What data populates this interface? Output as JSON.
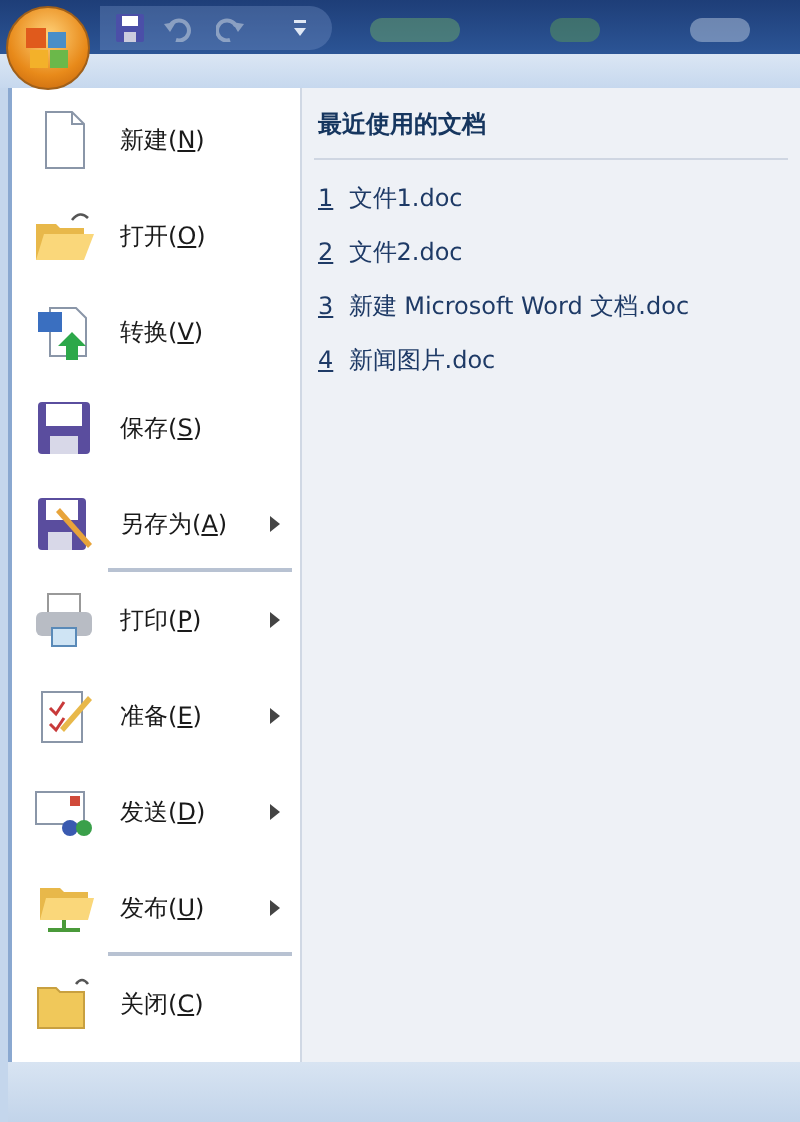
{
  "quick_access": [
    {
      "kind": "save",
      "disabled": false
    },
    {
      "kind": "undo",
      "disabled": true
    },
    {
      "kind": "redo",
      "disabled": true
    },
    {
      "kind": "customize",
      "disabled": false
    }
  ],
  "menu": [
    {
      "kind": "new",
      "label": "新建(",
      "accesskey": "N",
      "label_end": ")",
      "submenu": false,
      "separator_after": false
    },
    {
      "kind": "open",
      "label": "打开(",
      "accesskey": "O",
      "label_end": ")",
      "submenu": false,
      "separator_after": false
    },
    {
      "kind": "convert",
      "label": "转换(",
      "accesskey": "V",
      "label_end": ")",
      "submenu": false,
      "separator_after": false
    },
    {
      "kind": "save",
      "label": "保存(",
      "accesskey": "S",
      "label_end": ")",
      "submenu": false,
      "separator_after": false
    },
    {
      "kind": "saveas",
      "label": "另存为(",
      "accesskey": "A",
      "label_end": ")",
      "submenu": true,
      "separator_after": true
    },
    {
      "kind": "print",
      "label": "打印(",
      "accesskey": "P",
      "label_end": ")",
      "submenu": true,
      "separator_after": false
    },
    {
      "kind": "prepare",
      "label": "准备(",
      "accesskey": "E",
      "label_end": ")",
      "submenu": true,
      "separator_after": false
    },
    {
      "kind": "send",
      "label": "发送(",
      "accesskey": "D",
      "label_end": ")",
      "submenu": true,
      "separator_after": false
    },
    {
      "kind": "publish",
      "label": "发布(",
      "accesskey": "U",
      "label_end": ")",
      "submenu": true,
      "separator_after": true
    },
    {
      "kind": "close",
      "label": "关闭(",
      "accesskey": "C",
      "label_end": ")",
      "submenu": false,
      "separator_after": false
    }
  ],
  "recent": {
    "title": "最近使用的文档",
    "items": [
      {
        "number": "1",
        "name": "文件1.doc"
      },
      {
        "number": "2",
        "name": "文件2.doc"
      },
      {
        "number": "3",
        "name": "新建 Microsoft Word 文档.doc"
      },
      {
        "number": "4",
        "name": "新闻图片.doc"
      }
    ]
  }
}
